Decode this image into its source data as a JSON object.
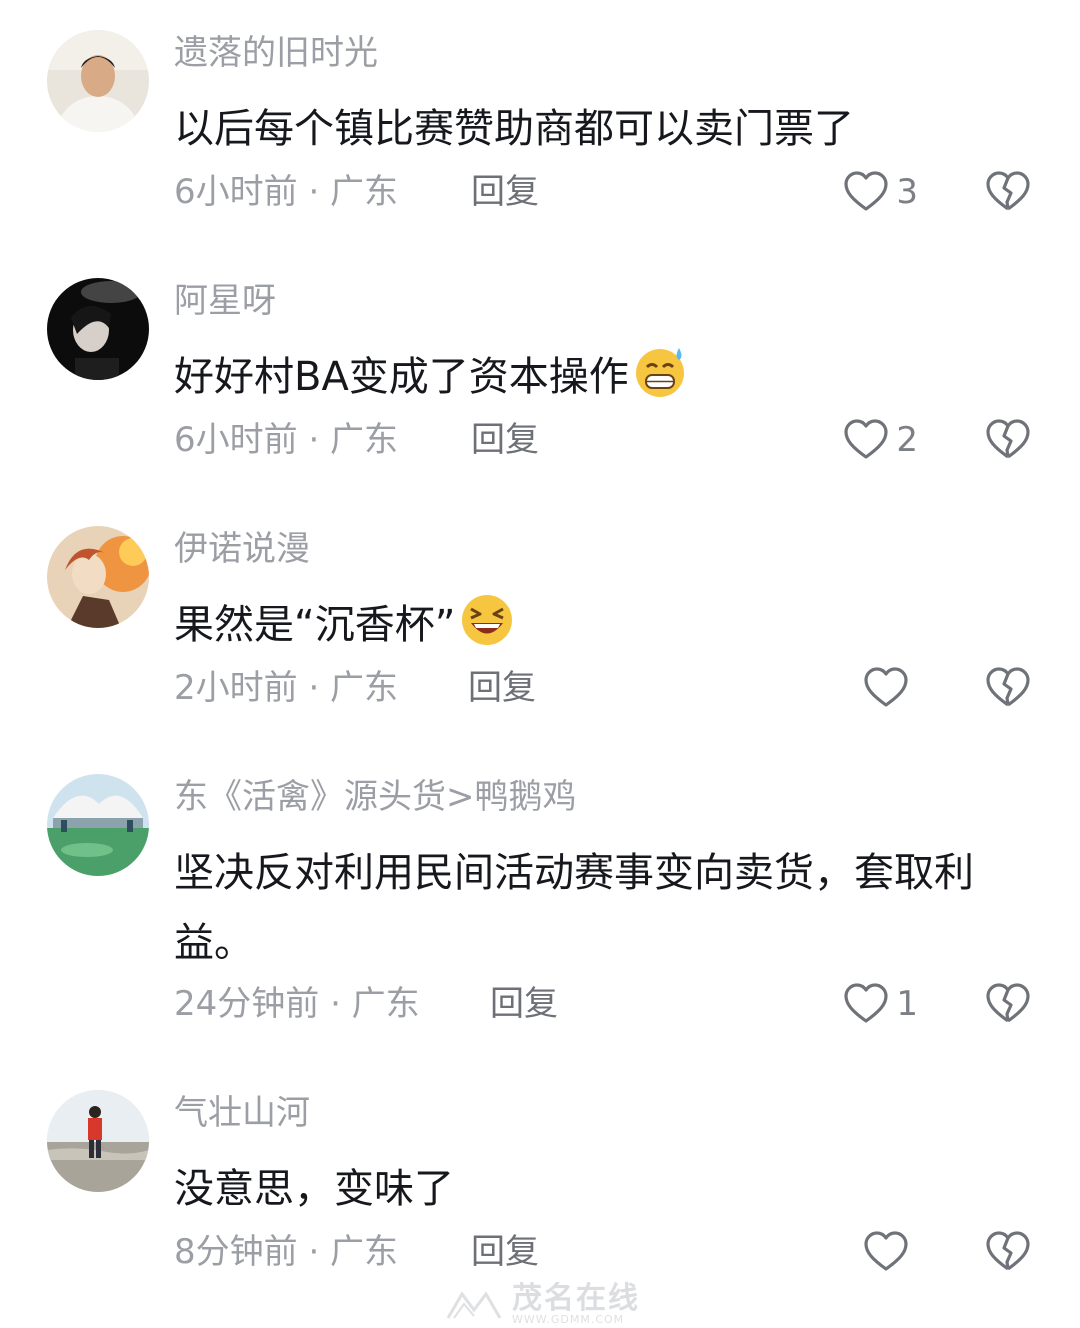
{
  "comments": [
    {
      "username": "遗落的旧时光",
      "text": "以后每个镇比赛赞助商都可以卖门票了",
      "emoji": "",
      "time_location": "6小时前 · 广东",
      "reply_label": "回复",
      "likes": "3"
    },
    {
      "username": "阿星呀",
      "text": "好好村BA变成了资本操作",
      "emoji": "grinning-sweat-emoji",
      "time_location": "6小时前 · 广东",
      "reply_label": "回复",
      "likes": "2"
    },
    {
      "username": "伊诺说漫",
      "text": "果然是“沉香杯”",
      "emoji": "laughing-squint-emoji",
      "time_location": "2小时前 · 广东",
      "reply_label": "回复",
      "likes": ""
    },
    {
      "username": "东《活禽》源头货>鸭鹅鸡",
      "text": "坚决反对利用民间活动赛事变向卖货，套取利益。",
      "emoji": "",
      "time_location": "24分钟前 · 广东",
      "reply_label": "回复",
      "likes": "1"
    },
    {
      "username": "气壮山河",
      "text": "没意思，变味了",
      "emoji": "",
      "time_location": "8分钟前 · 广东",
      "reply_label": "回复",
      "likes": ""
    }
  ],
  "icons": {
    "like": "heart-outline-icon",
    "dislike": "broken-heart-icon"
  },
  "watermark": {
    "main": "茂名在线",
    "sub": "WWW.GDMM.COM"
  },
  "colors": {
    "text": "#16181d",
    "muted": "#9b9ea4",
    "reply": "#6d7077",
    "icon": "#6f7278"
  }
}
